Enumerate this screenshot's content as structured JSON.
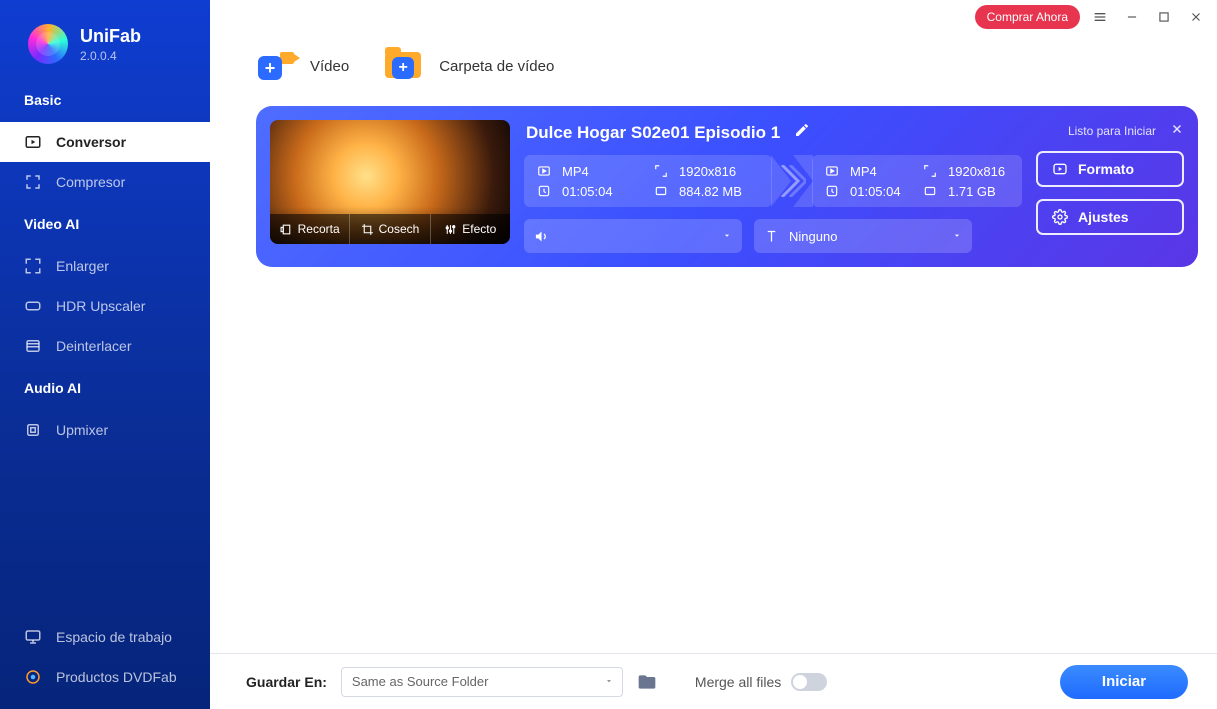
{
  "brand": {
    "name": "UniFab",
    "version": "2.0.0.4"
  },
  "titlebar": {
    "buy_label": "Comprar Ahora"
  },
  "sidebar": {
    "sections": {
      "basic": "Basic",
      "video_ai": "Video AI",
      "audio_ai": "Audio AI"
    },
    "items": {
      "conversor": "Conversor",
      "compresor": "Compresor",
      "enlarger": "Enlarger",
      "hdr": "HDR Upscaler",
      "deinterlacer": "Deinterlacer",
      "upmixer": "Upmixer",
      "workspace": "Espacio de trabajo",
      "products": "Productos DVDFab"
    }
  },
  "import": {
    "video": "Vídeo",
    "folder": "Carpeta de vídeo"
  },
  "task": {
    "title": "Dulce Hogar S02e01 Episodio 1",
    "status": "Listo para Iniciar",
    "edit_tabs": {
      "recortar": "Recorta",
      "cosechar": "Cosech",
      "efectos": "Efecto"
    },
    "input": {
      "format": "MP4",
      "resolution": "1920x816",
      "duration": "01:05:04",
      "size": "884.82 MB"
    },
    "output": {
      "format": "MP4",
      "resolution": "1920x816",
      "duration": "01:05:04",
      "size": "1.71 GB"
    },
    "subtitle_label": "Ninguno",
    "buttons": {
      "formato": "Formato",
      "ajustes": "Ajustes"
    }
  },
  "bottom": {
    "save_label": "Guardar En:",
    "save_value": "Same as Source Folder",
    "merge_label": "Merge all files",
    "start": "Iniciar"
  }
}
